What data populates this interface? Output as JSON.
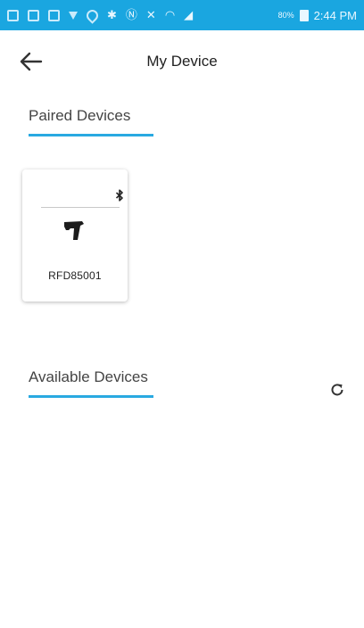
{
  "status_bar": {
    "time": "2:44 PM",
    "battery_text": "80%",
    "icons": [
      "notification-icon",
      "image-icon",
      "file-icon",
      "download-icon",
      "location-icon",
      "bluetooth-icon",
      "nfc-icon",
      "mute-icon",
      "wifi-icon",
      "signal-icon",
      "battery-icon"
    ]
  },
  "header": {
    "title": "My Device",
    "back_icon": "back-arrow-icon"
  },
  "paired": {
    "heading": "Paired Devices",
    "devices": [
      {
        "name": "RFD85001",
        "icon": "scanner-icon",
        "status_icon": "bluetooth-icon"
      }
    ]
  },
  "available": {
    "heading": "Available Devices",
    "refresh_icon": "refresh-icon"
  },
  "colors": {
    "status_bar": "#1aa6e0",
    "accent_underline": "#29a9e1"
  }
}
